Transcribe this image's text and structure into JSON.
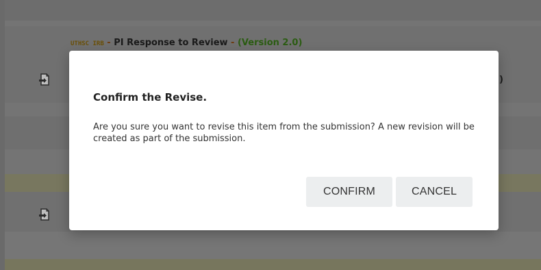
{
  "background": {
    "item_title": {
      "org": "UTHSC IRB",
      "sep1": " - ",
      "main": "PI Response to Review",
      "sep2": " - ",
      "version": "(Version 2.0)"
    },
    "truncated_text": ")"
  },
  "dialog": {
    "title": "Confirm the Revise.",
    "message": "Are you sure you want to revise this item from the submission? A new revision will be created as part of the submission.",
    "confirm_label": "CONFIRM",
    "cancel_label": "CANCEL"
  },
  "icons": {
    "row_icon_1": "document-revise-icon",
    "row_icon_2": "document-revise-icon"
  }
}
